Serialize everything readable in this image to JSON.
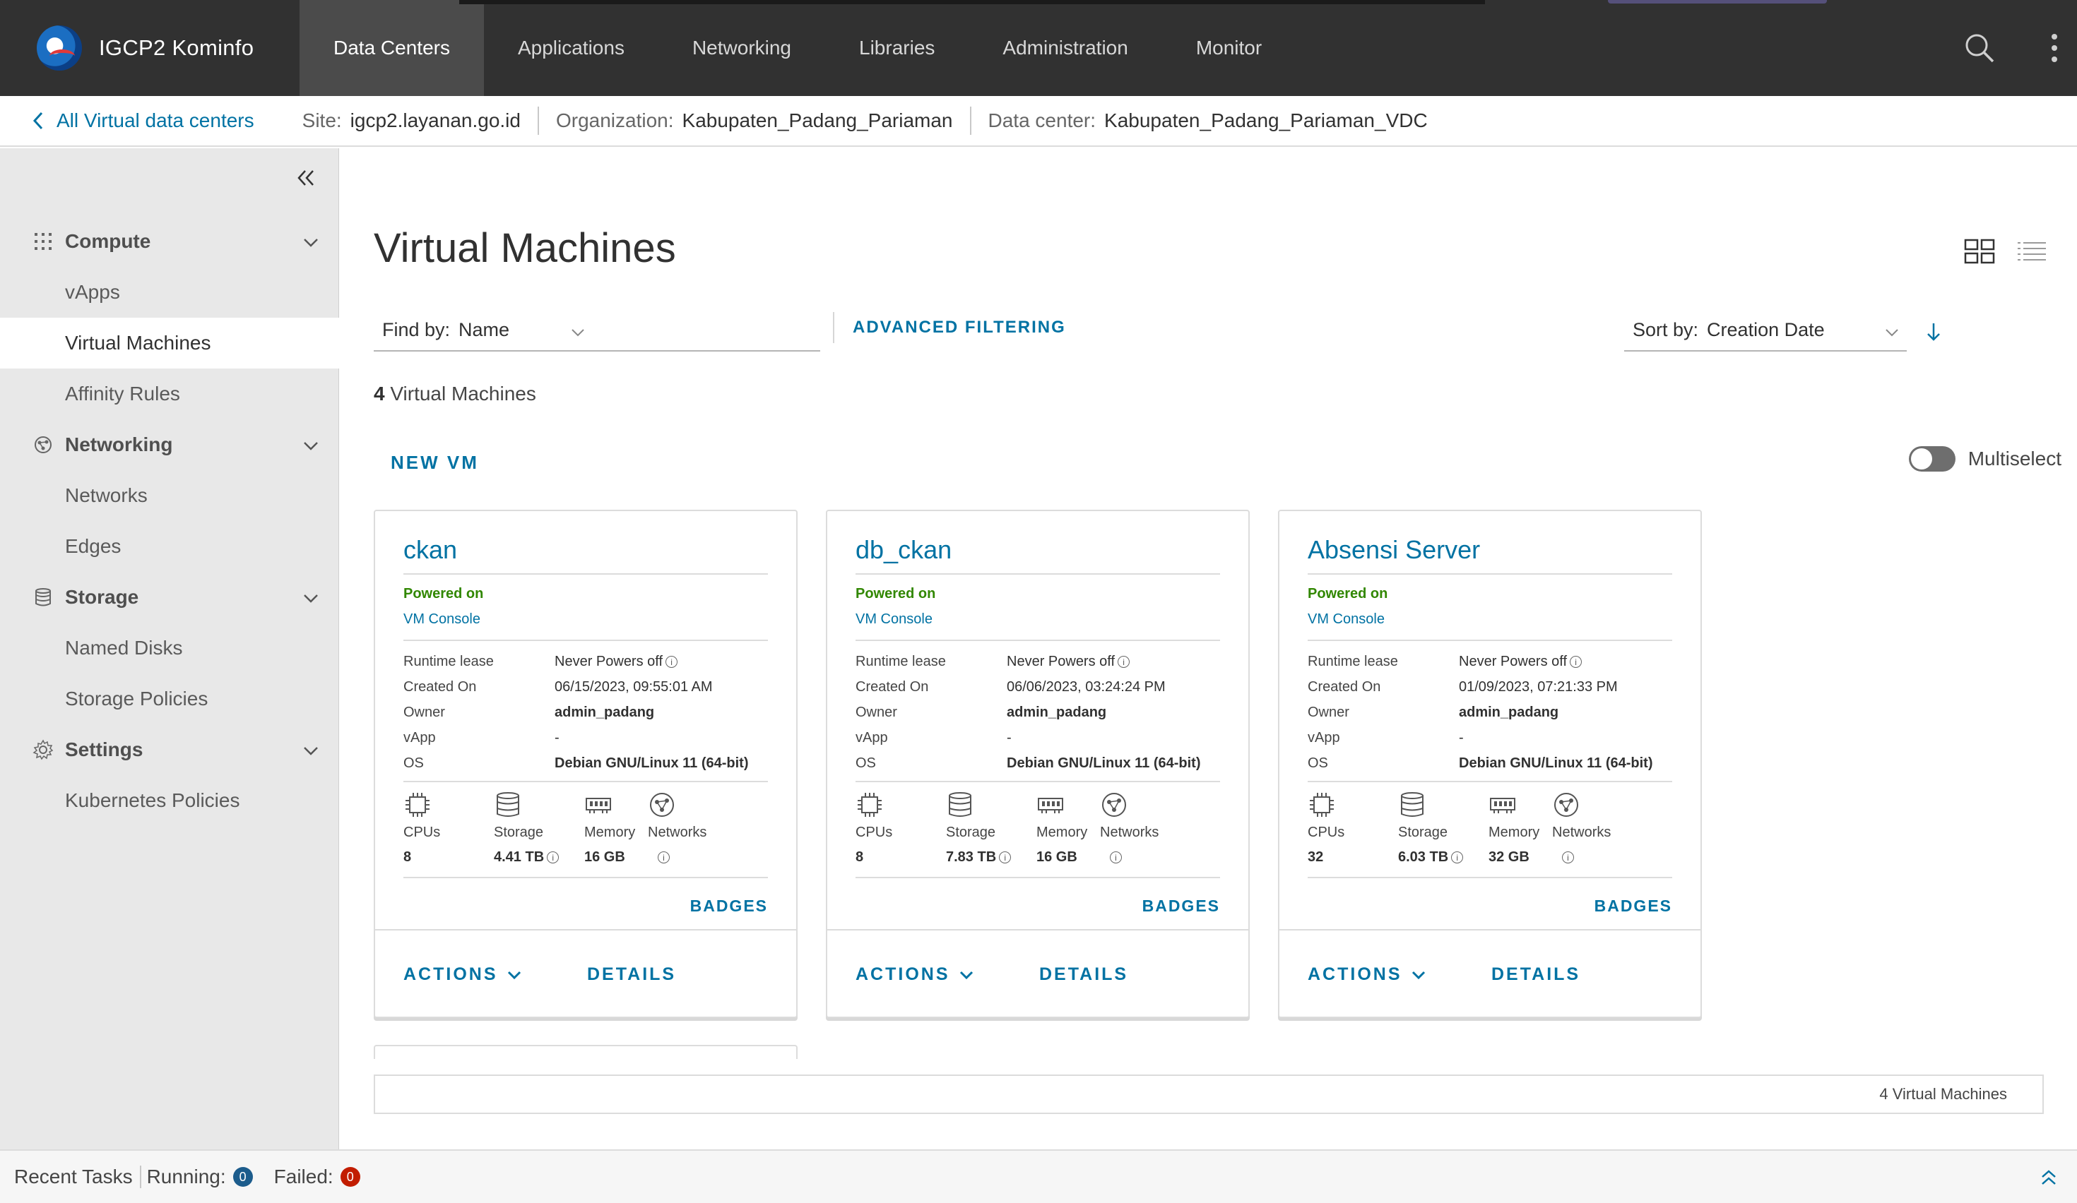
{
  "header": {
    "brand": "IGCP2 Kominfo",
    "nav": [
      "Data Centers",
      "Applications",
      "Networking",
      "Libraries",
      "Administration",
      "Monitor"
    ],
    "active_nav": "Data Centers"
  },
  "crumbs": {
    "back_label": "All Virtual data centers",
    "site_key": "Site:",
    "site_value": "igcp2.layanan.go.id",
    "org_key": "Organization:",
    "org_value": "Kabupaten_Padang_Pariaman",
    "dc_key": "Data center:",
    "dc_value": "Kabupaten_Padang_Pariaman_VDC"
  },
  "sidebar": {
    "compute": "Compute",
    "vapps": "vApps",
    "virtual_machines": "Virtual Machines",
    "affinity_rules": "Affinity Rules",
    "networking": "Networking",
    "networks": "Networks",
    "edges": "Edges",
    "storage": "Storage",
    "named_disks": "Named Disks",
    "storage_policies": "Storage Policies",
    "settings": "Settings",
    "kubernetes_policies": "Kubernetes Policies",
    "active": "Virtual Machines"
  },
  "main": {
    "title": "Virtual Machines",
    "find_by_key": "Find by:",
    "find_by_value": "Name",
    "advanced_filtering": "ADVANCED FILTERING",
    "sort_by_key": "Sort by:",
    "sort_by_value": "Creation Date",
    "count_number": "4",
    "count_label": "Virtual Machines",
    "new_vm": "NEW VM",
    "multiselect": "Multiselect",
    "multiselect_on": false,
    "footer_count": "4 Virtual Machines"
  },
  "labels": {
    "runtime_lease": "Runtime lease",
    "created_on": "Created On",
    "owner": "Owner",
    "vapp": "vApp",
    "os": "OS",
    "cpus": "CPUs",
    "storage": "Storage",
    "memory": "Memory",
    "networks": "Networks",
    "badges": "BADGES",
    "actions": "ACTIONS",
    "details": "DETAILS"
  },
  "vms": [
    {
      "name": "ckan",
      "status": "Powered on",
      "console": "VM Console",
      "runtime_lease": "Never Powers off",
      "created_on": "06/15/2023, 09:55:01 AM",
      "owner": "admin_padang",
      "vapp": "-",
      "os": "Debian GNU/Linux 11 (64-bit)",
      "cpus": "8",
      "storage": "4.41 TB",
      "memory": "16 GB"
    },
    {
      "name": "db_ckan",
      "status": "Powered on",
      "console": "VM Console",
      "runtime_lease": "Never Powers off",
      "created_on": "06/06/2023, 03:24:24 PM",
      "owner": "admin_padang",
      "vapp": "-",
      "os": "Debian GNU/Linux 11 (64-bit)",
      "cpus": "8",
      "storage": "7.83 TB",
      "memory": "16 GB"
    },
    {
      "name": "Absensi Server",
      "status": "Powered on",
      "console": "VM Console",
      "runtime_lease": "Never Powers off",
      "created_on": "01/09/2023, 07:21:33 PM",
      "owner": "admin_padang",
      "vapp": "-",
      "os": "Debian GNU/Linux 11 (64-bit)",
      "cpus": "32",
      "storage": "6.03 TB",
      "memory": "32 GB"
    }
  ],
  "tasks": {
    "recent": "Recent Tasks",
    "running_label": "Running:",
    "running_count": "0",
    "failed_label": "Failed:",
    "failed_count": "0"
  },
  "colors": {
    "header_bg": "#313131",
    "accent": "#0072a3",
    "powered_on": "#318700",
    "failed": "#c21d00"
  }
}
